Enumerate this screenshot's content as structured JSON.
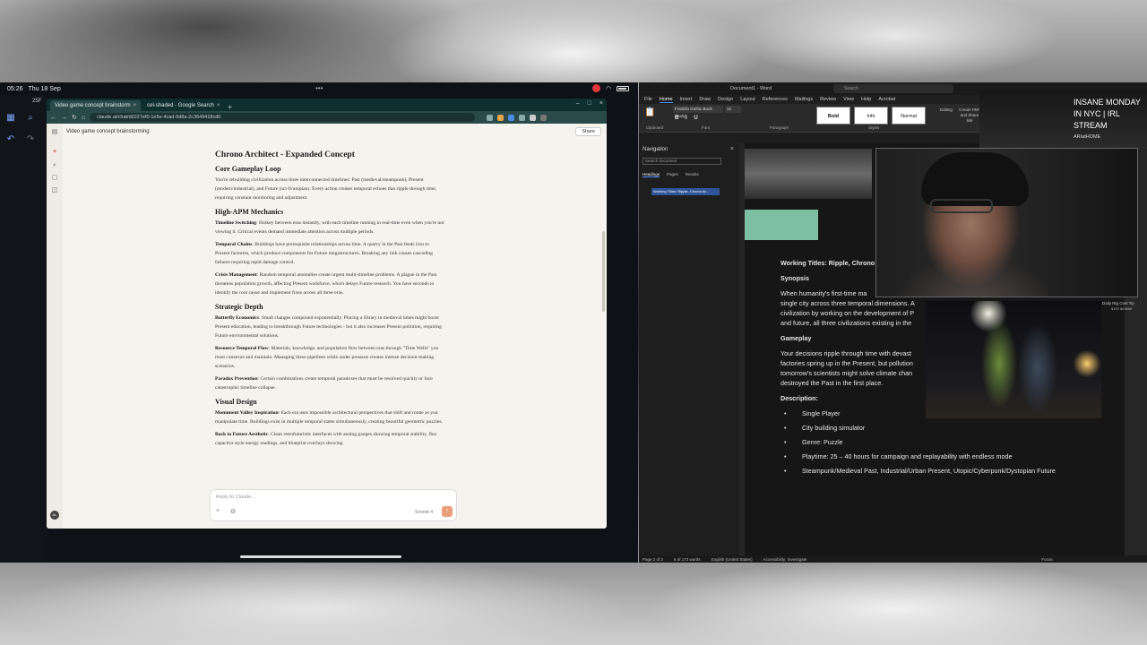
{
  "status_bar": {
    "time": "05:26",
    "date": "Thu 18 Sep",
    "rail_tab_label": "25F"
  },
  "browser": {
    "tabs": [
      {
        "label": "Video game concept brainstorm",
        "active": true
      },
      {
        "label": "cel-shaded - Google Search",
        "active": false
      }
    ],
    "address": "claude.ai/chat/d0227ef0-1e5e-4cad-9d8a-2c3649418cd0"
  },
  "claude": {
    "chat_title": "Video game concept brainstorming",
    "share_label": "Share",
    "doc": {
      "title": "Chrono Architect - Expanded Concept",
      "sections": [
        {
          "heading": "Core Gameplay Loop",
          "paragraphs": [
            {
              "bold": "",
              "text": "You're rebuilding civilization across three interconnected timelines: Past (medieval/steampunk), Present (modern/industrial), and Future (sci-fi/utopian). Every action creates temporal echoes that ripple through time, requiring constant monitoring and adjustment."
            }
          ]
        },
        {
          "heading": "High-APM Mechanics",
          "paragraphs": [
            {
              "bold": "Timeline Switching",
              "text": ": Hotkey between eras instantly, with each timeline running in real-time even when you're not viewing it. Critical events demand immediate attention across multiple periods."
            },
            {
              "bold": "Temporal Chains",
              "text": ": Buildings have prerequisite relationships across time. A quarry in the Past feeds iron to Present factories, which produce components for Future megastructures. Breaking any link causes cascading failures requiring rapid damage control."
            },
            {
              "bold": "Crisis Management",
              "text": ": Random temporal anomalies create urgent multi-timeline problems. A plague in the Past threatens population growth, affecting Present workforce, which delays Future research. You have seconds to identify the root cause and implement fixes across all three eras."
            }
          ]
        },
        {
          "heading": "Strategic Depth",
          "paragraphs": [
            {
              "bold": "Butterfly Economics",
              "text": ": Small changes compound exponentially. Placing a library in medieval times might boost Present education, leading to breakthrough Future technologies - but it also increases Present pollution, requiring Future environmental solutions."
            },
            {
              "bold": "Resource Temporal Flow",
              "text": ": Materials, knowledge, and population flow between eras through \"Time Wells\" you must construct and maintain. Managing these pipelines while under pressure creates intense decision-making scenarios."
            },
            {
              "bold": "Paradox Prevention",
              "text": ": Certain combinations create temporal paradoxes that must be resolved quickly or face catastrophic timeline collapse."
            }
          ]
        },
        {
          "heading": "Visual Design",
          "paragraphs": [
            {
              "bold": "Monument Valley Inspiration",
              "text": ": Each era uses impossible architectural perspectives that shift and rotate as you manipulate time. Buildings exist in multiple temporal states simultaneously, creating beautiful geometric puzzles."
            },
            {
              "bold": "Back to Future Aesthetic",
              "text": ": Clean retrofuturistic interfaces with analog gauges showing temporal stability, flux capacitor style energy readings, and blueprint overlays showing"
            }
          ]
        }
      ]
    },
    "reply_placeholder": "Reply to Claude...",
    "model_label": "Sonnet 4"
  },
  "word": {
    "title_bar": "Document1 - Word",
    "search_placeholder": "Search",
    "menu": [
      "File",
      "Home",
      "Insert",
      "Draw",
      "Design",
      "Layout",
      "References",
      "Mailings",
      "Review",
      "View",
      "Help",
      "Acrobat"
    ],
    "active_menu": "Home",
    "font_name": "Franklin Gothic Book (Body)",
    "font_size": "12",
    "format_buttons": "B I U",
    "styles": [
      "Bold",
      "Info",
      "Normal"
    ],
    "ribbon_groups": [
      "Clipboard",
      "Font",
      "Paragraph",
      "Styles"
    ],
    "ribbon_tools": [
      "Editing",
      "Create PDF and Share link"
    ],
    "nav": {
      "title": "Navigation",
      "search_placeholder": "Search document",
      "tabs": [
        "Headings",
        "Pages",
        "Results"
      ],
      "heading_item": "Working Titles: Ripple, Chrono Ar..."
    },
    "page_lines": [
      {
        "text": "Working Titles: Ripple, Chrono",
        "style": "bold"
      },
      {
        "text": "Synopsis",
        "style": "bold"
      },
      {
        "text": "When humanity's first-time ma",
        "style": "normal"
      },
      {
        "text": "single city across three temporal dimensions. A",
        "style": "normal"
      },
      {
        "text": "civilization by working on the development of P",
        "style": "normal"
      },
      {
        "text": "and future, all three civilizations existing in the",
        "style": "normal"
      },
      {
        "text": "Gameplay",
        "style": "bold"
      },
      {
        "text": "Your decisions ripple through time with devast",
        "style": "normal"
      },
      {
        "text": "factories spring up in the Present, but pollution",
        "style": "normal"
      },
      {
        "text": "tomorrow's scientists might solve climate chan",
        "style": "normal"
      },
      {
        "text": "destroyed the Past in the first place.",
        "style": "normal"
      },
      {
        "text": "Description:",
        "style": "bold"
      },
      {
        "text": "Single Player",
        "style": "bullet"
      },
      {
        "text": "City building simulator",
        "style": "bullet"
      },
      {
        "text": "Genre: Puzzle",
        "style": "bullet"
      },
      {
        "text": "Playtime: 25 – 40 hours for campaign and replayability with endless mode",
        "style": "bullet"
      },
      {
        "text": "Steampunk/Medieval Past, Industrial/Urban Present, Utopic/Cyberpunk/Dystopian Future",
        "style": "bullet"
      }
    ],
    "status": [
      "Page 2 of 2",
      "6 of 173 words",
      "English (United States)",
      "Accessibility: Investigate",
      "Focus"
    ]
  },
  "stream": {
    "title": "INSANE MONDAY IN NYC | IRL STREAM",
    "handle": "ARIatHOME",
    "rig_label": "Daily Rig Cost Tip",
    "rig_amount": "$100 $63868"
  },
  "colors": {
    "word_accent": "#4e8cff",
    "teal_block": "#7dbfa3",
    "record": "#e03b3b"
  }
}
